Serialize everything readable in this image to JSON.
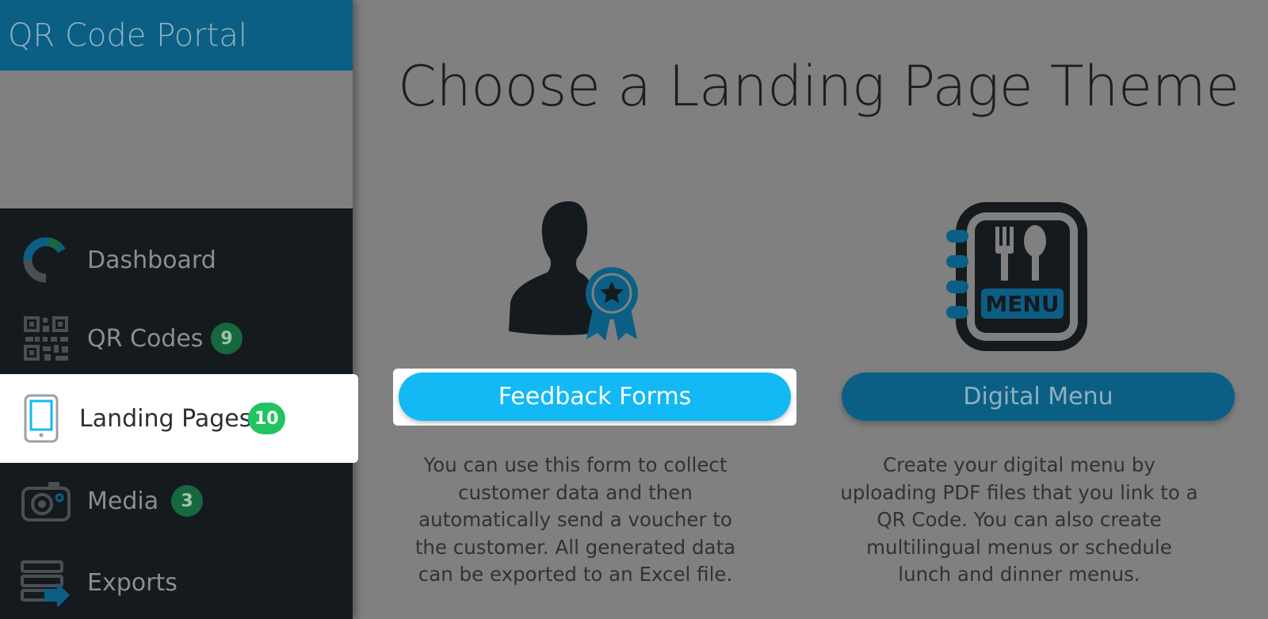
{
  "app": {
    "title": "QR Code Portal"
  },
  "sidebar": {
    "items": [
      {
        "label": "Dashboard",
        "icon": "dashboard-donut-icon",
        "badge": null
      },
      {
        "label": "QR Codes",
        "icon": "qr-code-icon",
        "badge": "9"
      },
      {
        "label": "Landing Pages",
        "icon": "tablet-icon",
        "badge": "10",
        "active": true
      },
      {
        "label": "Media",
        "icon": "camera-icon",
        "badge": "3"
      },
      {
        "label": "Exports",
        "icon": "export-icon",
        "badge": null
      }
    ]
  },
  "main": {
    "title": "Choose a Landing Page Theme",
    "themes": [
      {
        "button_label": "Feedback Forms",
        "icon": "person-award-icon",
        "description": "You can use this form to collect customer data and then automatically send a voucher to the customer. All generated data can be exported to an Excel file."
      },
      {
        "button_label": "Digital Menu",
        "icon": "menu-book-icon",
        "icon_text": "MENU",
        "description": "Create your digital menu by uploading PDF files that you link to a QR Code. You can also create multilingual menus or schedule lunch and dinner menus."
      }
    ]
  },
  "colors": {
    "brand": "#0b5f84",
    "accent": "#12b9f5",
    "badge_active": "#21c45f",
    "sidebar_bg": "#151a1f"
  }
}
